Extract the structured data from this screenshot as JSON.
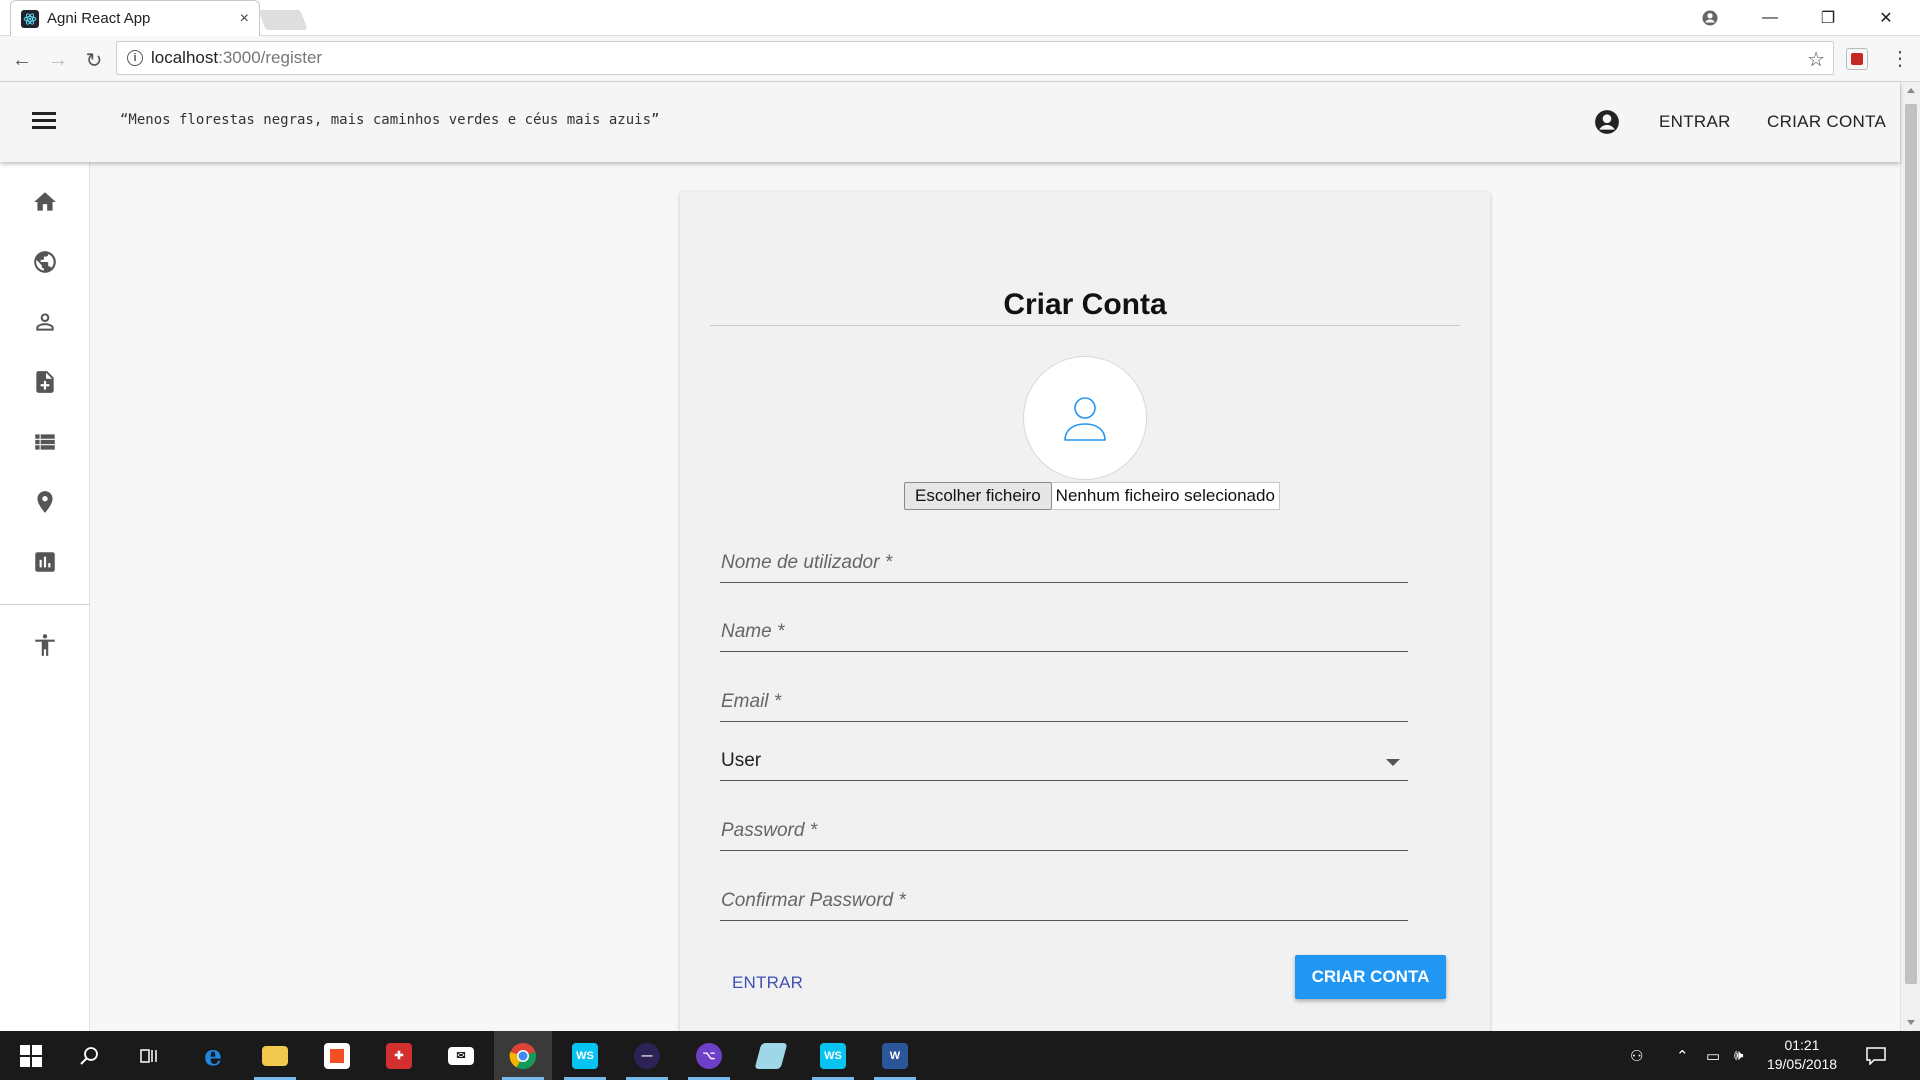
{
  "browser": {
    "tab_title": "Agni React App",
    "tab_close": "×",
    "url_host": "localhost",
    "url_path": ":3000/register",
    "window_controls": {
      "minimize": "—",
      "restore": "❐",
      "close": "✕"
    }
  },
  "appbar": {
    "quote": "“Menos florestas negras, mais caminhos verdes e céus mais azuis”",
    "login_label": "ENTRAR",
    "register_label": "CRIAR CONTA"
  },
  "sidebar": {
    "items": [
      {
        "icon": "home-icon"
      },
      {
        "icon": "globe-icon"
      },
      {
        "icon": "person-icon"
      },
      {
        "icon": "add-document-icon"
      },
      {
        "icon": "list-icon"
      },
      {
        "icon": "location-pin-icon"
      },
      {
        "icon": "bar-chart-icon"
      },
      {
        "icon": "accessibility-icon"
      }
    ]
  },
  "form": {
    "title": "Criar Conta",
    "file_button": "Escolher ficheiro",
    "file_status": "Nenhum ficheiro selecionado",
    "fields": {
      "username": "Nome de utilizador *",
      "name": "Name *",
      "email": "Email *",
      "role_value": "User",
      "password": "Password *",
      "confirm_password": "Confirmar Password *"
    },
    "secondary_button": "ENTRAR",
    "primary_button": "CRIAR CONTA"
  },
  "colors": {
    "primary": "#2196f3",
    "link": "#3f51b5"
  },
  "taskbar": {
    "time": "01:21",
    "date": "19/05/2018"
  }
}
